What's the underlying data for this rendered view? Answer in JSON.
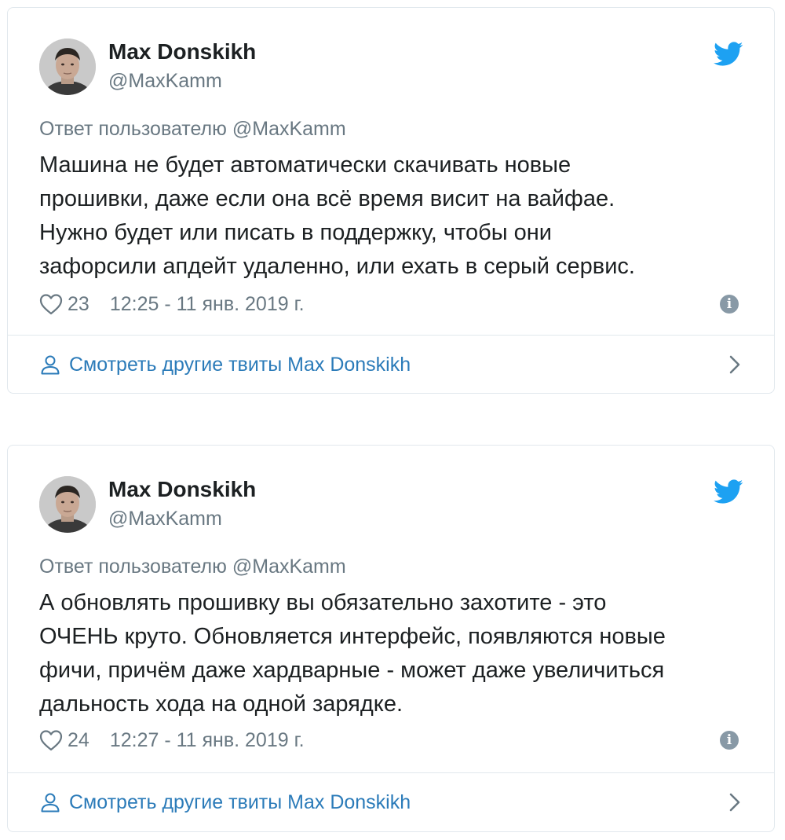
{
  "tweets": [
    {
      "author_name": "Max Donskikh",
      "author_handle": "@MaxKamm",
      "reply_prefix": "Ответ пользователю",
      "reply_mention": "@MaxKamm",
      "text": "Машина не будет автоматически скачивать новые\nпрошивки, даже если она всё время висит на вайфае.\nНужно будет или писать в поддержку, чтобы они\nзафорсили апдейт удаленно, или ехать в серый сервис.",
      "likes": "23",
      "timestamp": "12:25 - 11 янв. 2019 г.",
      "more_link": "Смотреть другие твиты Max Donskikh"
    },
    {
      "author_name": "Max Donskikh",
      "author_handle": "@MaxKamm",
      "reply_prefix": "Ответ пользователю",
      "reply_mention": "@MaxKamm",
      "text": "А обновлять прошивку вы обязательно захотите  - это\nОЧЕНЬ круто. Обновляется интерфейс, появляются новые\nфичи, причём даже хардварные - может даже увеличиться\nдальность хода на одной зарядке.",
      "likes": "24",
      "timestamp": "12:27 - 11 янв. 2019 г.",
      "more_link": "Смотреть другие твиты Max Donskikh"
    }
  ],
  "icons": {
    "avatar": "avatar",
    "brand": "twitter-bird-icon",
    "like": "heart-icon",
    "info": "info-icon",
    "profile": "person-icon",
    "arrow": "chevron-right-icon"
  },
  "colors": {
    "brand": "#1da1f2",
    "link": "#2b7bb9",
    "muted": "#697882",
    "border": "#e1e8ed",
    "text": "#1c2022"
  }
}
